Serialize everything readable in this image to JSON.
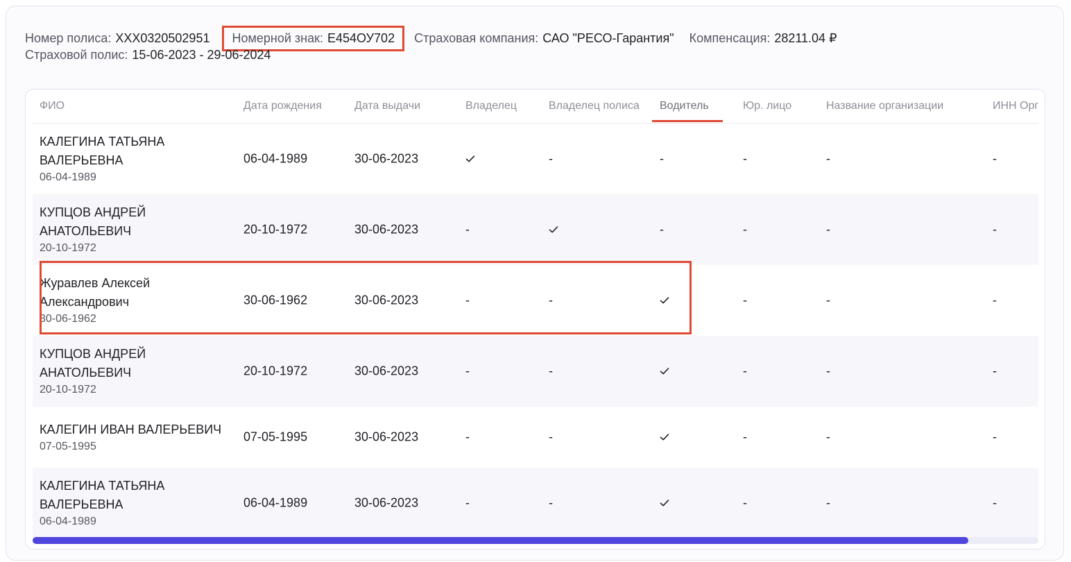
{
  "policy": {
    "number_label": "Номер полиса:",
    "number_value": "XXX0320502951",
    "plate_label": "Номерной знак:",
    "plate_value": "Е454ОУ702",
    "company_label": "Страховая компания:",
    "company_value": "САО \"РЕСО-Гарантия\"",
    "compensation_label": "Компенсация:",
    "compensation_value": "28211.04 ₽",
    "period_label": "Страховой полис:",
    "period_value": "15-06-2023 - 29-06-2024"
  },
  "table": {
    "columns": [
      "ФИО",
      "Дата рождения",
      "Дата выдачи",
      "Владелец",
      "Владелец полиса",
      "Водитель",
      "Юр. лицо",
      "Название организации",
      "ИНН Орг"
    ],
    "active_column": "Водитель",
    "rows": [
      {
        "name_lines": [
          "КАЛЕГИНА ТАТЬЯНА",
          "ВАЛЕРЬЕВНА"
        ],
        "name_sub": "06-04-1989",
        "birth": "06-04-1989",
        "issue": "30-06-2023",
        "owner": "check",
        "policy_owner": "-",
        "driver": "-",
        "legal": "-",
        "org_name": "-",
        "org_inn": "-"
      },
      {
        "name_lines": [
          "КУПЦОВ АНДРЕЙ",
          "АНАТОЛЬЕВИЧ"
        ],
        "name_sub": "20-10-1972",
        "birth": "20-10-1972",
        "issue": "30-06-2023",
        "owner": "-",
        "policy_owner": "check",
        "driver": "-",
        "legal": "-",
        "org_name": "-",
        "org_inn": "-"
      },
      {
        "name_lines": [
          "Журавлев Алексей",
          "Александрович"
        ],
        "name_sub": "30-06-1962",
        "birth": "30-06-1962",
        "issue": "30-06-2023",
        "owner": "-",
        "policy_owner": "-",
        "driver": "check",
        "legal": "-",
        "org_name": "-",
        "org_inn": "-"
      },
      {
        "name_lines": [
          "КУПЦОВ АНДРЕЙ",
          "АНАТОЛЬЕВИЧ"
        ],
        "name_sub": "20-10-1972",
        "birth": "20-10-1972",
        "issue": "30-06-2023",
        "owner": "-",
        "policy_owner": "-",
        "driver": "check",
        "legal": "-",
        "org_name": "-",
        "org_inn": "-"
      },
      {
        "name_lines": [
          "КАЛЕГИН ИВАН ВАЛЕРЬЕВИЧ"
        ],
        "name_sub": "07-05-1995",
        "birth": "07-05-1995",
        "issue": "30-06-2023",
        "owner": "-",
        "policy_owner": "-",
        "driver": "check",
        "legal": "-",
        "org_name": "-",
        "org_inn": "-"
      },
      {
        "name_lines": [
          "КАЛЕГИНА ТАТЬЯНА",
          "ВАЛЕРЬЕВНА"
        ],
        "name_sub": "06-04-1989",
        "birth": "06-04-1989",
        "issue": "30-06-2023",
        "owner": "-",
        "policy_owner": "-",
        "driver": "check",
        "legal": "-",
        "org_name": "-",
        "org_inn": "-"
      }
    ],
    "highlighted_row": 2,
    "scroll_fraction": 0.93
  },
  "colors": {
    "accent": "#e04a32",
    "scrollbar": "#5045dd",
    "text": "#1f1f24",
    "muted": "#8e8f99"
  },
  "icons": {
    "check": "check-icon"
  }
}
